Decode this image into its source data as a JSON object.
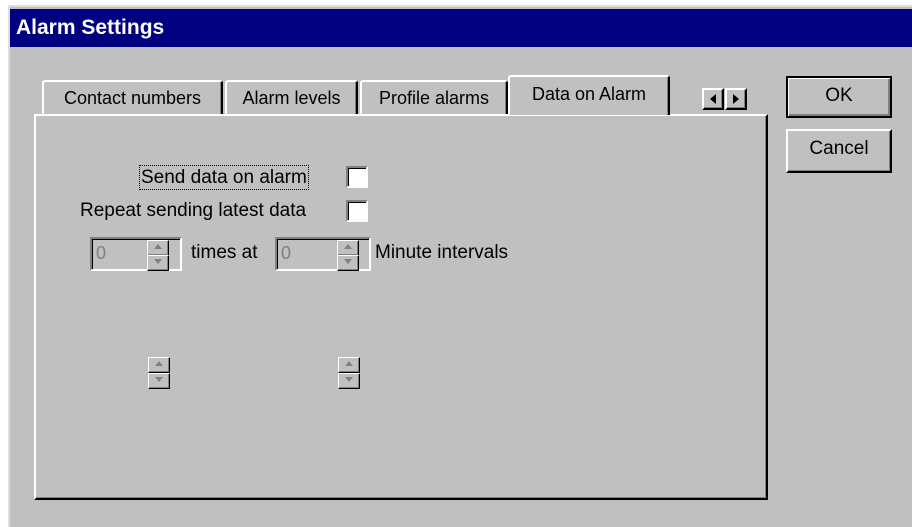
{
  "window": {
    "title": "Alarm Settings"
  },
  "tabs": [
    {
      "label": "Contact numbers",
      "active": false
    },
    {
      "label": "Alarm levels",
      "active": false
    },
    {
      "label": "Profile alarms",
      "active": false
    },
    {
      "label": "Data on Alarm",
      "active": true
    }
  ],
  "tab_scroll": {
    "left_icon": "arrow-left-icon",
    "right_icon": "arrow-right-icon"
  },
  "buttons": {
    "ok_label": "OK",
    "cancel_label": "Cancel"
  },
  "data_on_alarm": {
    "send_data_label": "Send data on alarm",
    "send_data_checked": false,
    "repeat_label": "Repeat sending latest data",
    "repeat_checked": false,
    "times_value": "0",
    "times_at_label": "times at",
    "interval_value": "0",
    "minute_intervals_label": "Minute intervals"
  },
  "colors": {
    "titlebar": "#000080",
    "face": "#c0c0c0"
  }
}
